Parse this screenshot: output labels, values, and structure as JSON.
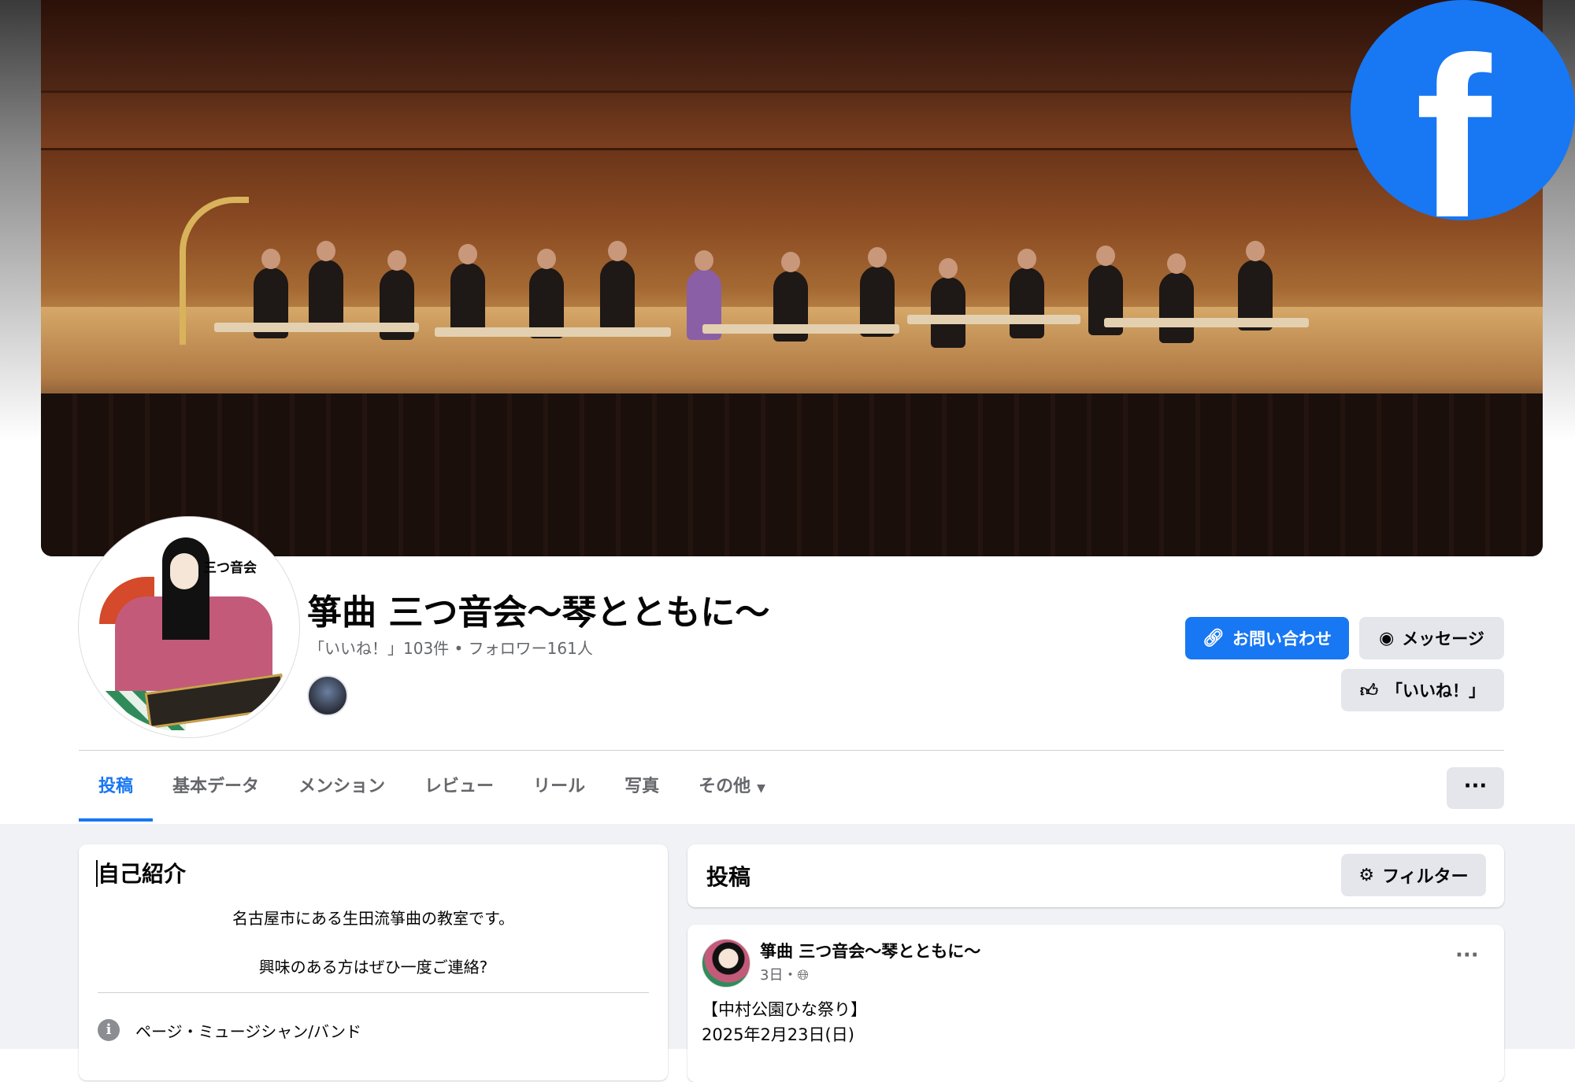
{
  "page": {
    "title": "箏曲 三つ音会〜琴とともに〜",
    "stats": "「いいね！」103件 • フォロワー161人",
    "avatar_text": "三つ音会"
  },
  "brand": {
    "logo_letter": "f",
    "accent_color": "#1877F2"
  },
  "actions": {
    "contact_label": "お問い合わせ",
    "message_label": "メッセージ",
    "like_label": "「いいね！」",
    "more_label": "···"
  },
  "tabs": [
    {
      "label": "投稿",
      "active": true
    },
    {
      "label": "基本データ"
    },
    {
      "label": "メンション"
    },
    {
      "label": "レビュー"
    },
    {
      "label": "リール"
    },
    {
      "label": "写真"
    },
    {
      "label": "その他"
    }
  ],
  "intro": {
    "heading": "自己紹介",
    "line1": "名古屋市にある生田流箏曲の教室です。",
    "line2": "興味のある方はぜひ一度ご連絡?",
    "category": "ページ・ミュージシャン/バンド"
  },
  "posts": {
    "heading": "投稿",
    "filter_label": "フィルター",
    "first": {
      "author": "箏曲 三つ音会〜琴とともに〜",
      "time": "3日・",
      "line1": "【中村公園ひな祭り】",
      "line2": "2025年2月23日(日)"
    }
  },
  "icons": [
    "facebook-logo-icon",
    "link-icon",
    "messenger-icon",
    "thumbs-up-icon",
    "caret-down-icon",
    "more-dots-icon",
    "info-icon",
    "filter-icon",
    "globe-icon"
  ]
}
